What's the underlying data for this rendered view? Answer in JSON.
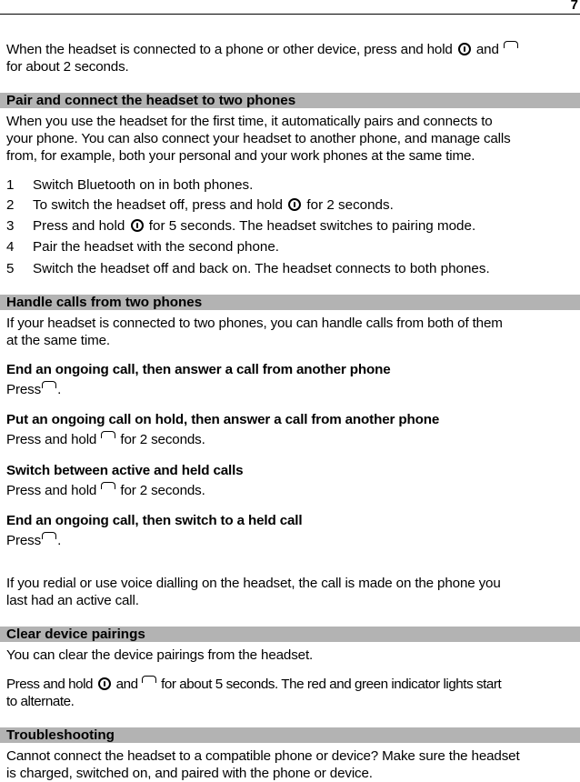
{
  "page": {
    "number": "7"
  },
  "intro": {
    "text_1": "When the headset is connected to a phone or other device, press and hold",
    "text_2": "and",
    "text_3": "for about 2 seconds.",
    "icons": [
      "power-key-icon",
      "call-key-icon"
    ]
  },
  "sections": {
    "pair": {
      "title": "Pair and connect the headset to two phones",
      "lines": [
        "When you use the headset for the first time, it automatically pairs and connects to",
        "your phone. You can also connect your headset to another phone, and manage calls",
        "from, for example, both your personal and your work phones at the same time."
      ],
      "steps": [
        {
          "num": "1",
          "text": "Switch Bluetooth on in both phones."
        },
        {
          "num": "2",
          "text_a": "To switch the headset off, press and hold",
          "text_b": "for 2 seconds."
        },
        {
          "num": "3",
          "text_a": "Press and hold",
          "text_b": "for 5 seconds. The headset switches to pairing mode."
        },
        {
          "num": "4",
          "text": "Pair the headset with the second phone."
        },
        {
          "num": "5",
          "text": "Switch the headset off and back on. The headset connects to both phones."
        }
      ]
    },
    "handle": {
      "title": "Handle calls from two phones",
      "lines": [
        "If your headset is connected to two phones, you can handle calls from both of them",
        "at the same time."
      ],
      "subsections": [
        {
          "heading": "End an ongoing call, then answer a call from another phone",
          "text_a": "Press",
          "text_b": "."
        },
        {
          "heading": "Put an ongoing call on hold, then answer a call from another phone",
          "text_a": "Press and hold",
          "text_b": "for 2 seconds."
        },
        {
          "heading": "Switch between active and held calls",
          "text_a": "Press and hold",
          "text_b": "for 2 seconds."
        },
        {
          "heading": "End an ongoing call, then switch to a held call",
          "text_a": "Press",
          "text_b": "."
        }
      ],
      "note_lines": [
        "If you redial or use voice dialling on the headset, the call is made on the phone you",
        "last had an active call."
      ]
    },
    "clear": {
      "title": "Clear device pairings",
      "line": "You can clear the device pairings from the headset.",
      "instr_a": "Press and hold",
      "instr_b": "and",
      "instr_c": "for about 5 seconds. The red and green indicator lights start",
      "instr_d": "to alternate."
    },
    "trouble": {
      "title": "Troubleshooting",
      "lines": [
        "Cannot connect the headset to a compatible phone or device? Make sure the headset",
        "is charged, switched on, and paired with the phone or device."
      ]
    }
  },
  "colors": {
    "section_bar": "#b3b3b3",
    "text": "#000000",
    "background": "#ffffff"
  }
}
